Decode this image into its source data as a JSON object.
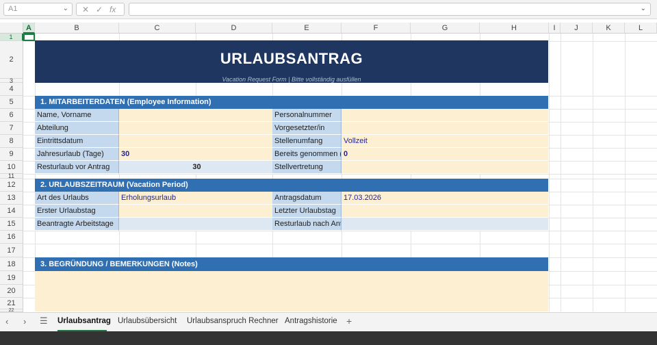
{
  "formula_bar": {
    "name_box": "A1",
    "cancel_icon": "✕",
    "enter_icon": "✓",
    "fx_icon": "fx",
    "formula_value": ""
  },
  "columns": [
    "A",
    "B",
    "C",
    "D",
    "E",
    "F",
    "G",
    "H",
    "I",
    "J",
    "K",
    "L"
  ],
  "rows": [
    "1",
    "2",
    "3",
    "4",
    "5",
    "6",
    "7",
    "8",
    "9",
    "10",
    "11",
    "12",
    "13",
    "14",
    "15",
    "16",
    "17",
    "18",
    "19",
    "20",
    "21",
    "22"
  ],
  "form": {
    "title": "URLAUBSANTRAG",
    "subtitle": "Vacation Request Form  |  Bitte vollständig ausfüllen",
    "section1": "1. MITARBEITERDATEN  (Employee Information)",
    "section2": "2. URLAUBSZEITRAUM  (Vacation Period)",
    "section3": "3. BEGRÜNDUNG / BEMERKUNGEN  (Notes)",
    "name_label": "Name, Vorname",
    "department_label": "Abteilung",
    "entry_label": "Eintrittsdatum",
    "annual_label": "Jahresurlaub (Tage)",
    "annual_value": "30",
    "remaining_label": "Resturlaub vor Antrag",
    "remaining_value": "30",
    "personnel_label": "Personalnummer",
    "supervisor_label": "Vorgesetzter/in",
    "scope_label": "Stellenumfang",
    "scope_value": "Vollzeit",
    "taken_label": "Bereits genommen (T",
    "taken_value": "0",
    "deputy_label": "Stellvertretung",
    "type_label": "Art des Urlaubs",
    "type_value": "Erholungsurlaub",
    "first_day_label": "Erster Urlaubstag",
    "workdays_label": "Beantragte Arbeitstage",
    "request_date_label": "Antragsdatum",
    "request_date_value": "17.03.2026",
    "last_day_label": "Letzter Urlaubstag",
    "remaining_after_label": "Resturlaub nach Antr"
  },
  "tabs": {
    "active": "Urlaubsantrag",
    "overview": "Urlaubsübersicht",
    "calculator": "Urlaubsanspruch Rechner",
    "history": "Antragshistorie",
    "add": "+"
  }
}
